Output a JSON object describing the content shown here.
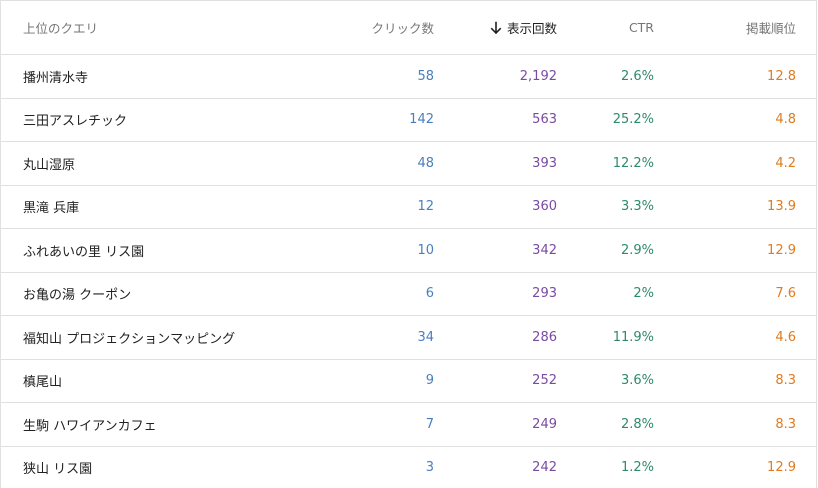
{
  "colors": {
    "clicks": "#4a7fbf",
    "impressions": "#7a4aa3",
    "ctr": "#2e8a6a",
    "position": "#e07b1f"
  },
  "header": {
    "query": "上位のクエリ",
    "clicks": "クリック数",
    "impressions": "表示回数",
    "impressions_sort_icon": "arrow-down-icon",
    "ctr": "CTR",
    "position": "掲載順位"
  },
  "rows": [
    {
      "query": "播州清水寺",
      "clicks": "58",
      "impressions": "2,192",
      "ctr": "2.6%",
      "position": "12.8"
    },
    {
      "query": "三田アスレチック",
      "clicks": "142",
      "impressions": "563",
      "ctr": "25.2%",
      "position": "4.8"
    },
    {
      "query": "丸山湿原",
      "clicks": "48",
      "impressions": "393",
      "ctr": "12.2%",
      "position": "4.2"
    },
    {
      "query": "黒滝 兵庫",
      "clicks": "12",
      "impressions": "360",
      "ctr": "3.3%",
      "position": "13.9"
    },
    {
      "query": "ふれあいの里 リス園",
      "clicks": "10",
      "impressions": "342",
      "ctr": "2.9%",
      "position": "12.9"
    },
    {
      "query": "お亀の湯 クーポン",
      "clicks": "6",
      "impressions": "293",
      "ctr": "2%",
      "position": "7.6"
    },
    {
      "query": "福知山 プロジェクションマッピング",
      "clicks": "34",
      "impressions": "286",
      "ctr": "11.9%",
      "position": "4.6"
    },
    {
      "query": "槙尾山",
      "clicks": "9",
      "impressions": "252",
      "ctr": "3.6%",
      "position": "8.3"
    },
    {
      "query": "生駒 ハワイアンカフェ",
      "clicks": "7",
      "impressions": "249",
      "ctr": "2.8%",
      "position": "8.3"
    },
    {
      "query": "狭山 リス園",
      "clicks": "3",
      "impressions": "242",
      "ctr": "1.2%",
      "position": "12.9"
    }
  ]
}
